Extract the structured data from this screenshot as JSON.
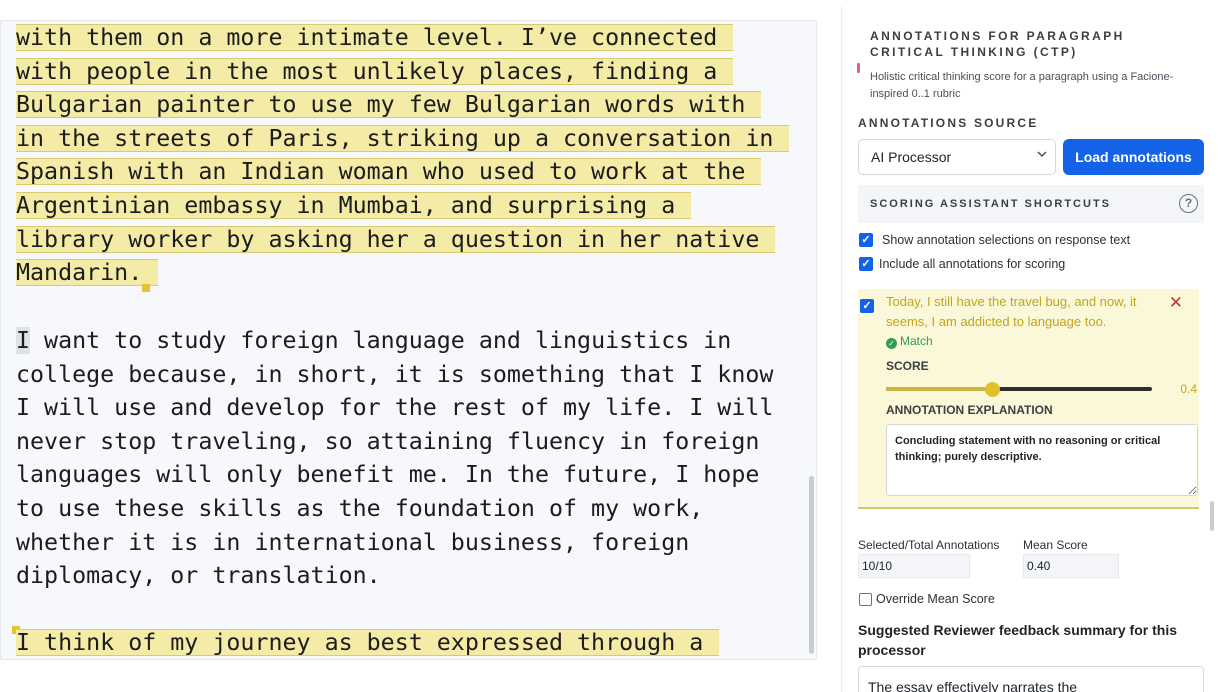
{
  "essay": {
    "paragraph1": [
      "with them on a more intimate level. I’ve connected",
      "with people in the most unlikely places, finding a",
      "Bulgarian painter to use my few Bulgarian words with",
      "in the streets of Paris, striking up a conversation in",
      "Spanish with an Indian woman who used to work at the",
      "Argentinian embassy in Mumbai, and surprising a",
      "library worker by asking her a question in her native",
      "Mandarin."
    ],
    "paragraph2": [
      "I want to study foreign language and linguistics in",
      "college because, in short, it is something that I know",
      "I will use and develop for the rest of my life. I will",
      "never stop traveling, so attaining fluency in foreign",
      "languages will only benefit me. In the future, I hope",
      "to use these skills as the foundation of my work,",
      "whether it is in international business, foreign",
      "diplomacy, or translation."
    ],
    "paragraph3": [
      "I think of my journey as best expressed through a"
    ]
  },
  "panel": {
    "title": "ANNOTATIONS FOR PARAGRAPH CRITICAL THINKING (CTP)",
    "subtitle": "Holistic critical thinking score for a paragraph using a Facione-inspired 0..1 rubric",
    "source_label": "ANNOTATIONS SOURCE",
    "source_selected": "AI Processor",
    "load_button": "Load annotations",
    "shortcuts_label": "SCORING ASSISTANT SHORTCUTS",
    "help_glyph": "?",
    "show_selections_label": "Show annotation selections on response text",
    "include_all_label": "Include all annotations for scoring",
    "annotation": {
      "quote": "Today, I still have the travel bug, and now, it seems, I am addicted to language too.",
      "close_glyph": "✕",
      "match_label": "Match",
      "score_label": "SCORE",
      "score_value": "0.4",
      "score_fraction": 0.4,
      "explanation_label": "ANNOTATION EXPLANATION",
      "explanation": "Concluding statement with no reasoning or critical thinking; purely descriptive."
    },
    "selected_total_label": "Selected/Total Annotations",
    "selected_total_value": "10/10",
    "mean_score_label": "Mean Score",
    "mean_score_value": "0.40",
    "override_label": "Override Mean Score",
    "feedback_title": "Suggested Reviewer feedback summary for this processor",
    "feedback_text": "The essay effectively narrates the"
  },
  "colors": {
    "highlight": "#f3eba6",
    "primary_button": "#1462e8",
    "match_green": "#2e9e4f",
    "close_red": "#c0392b",
    "annotation_text": "#c2a519"
  }
}
